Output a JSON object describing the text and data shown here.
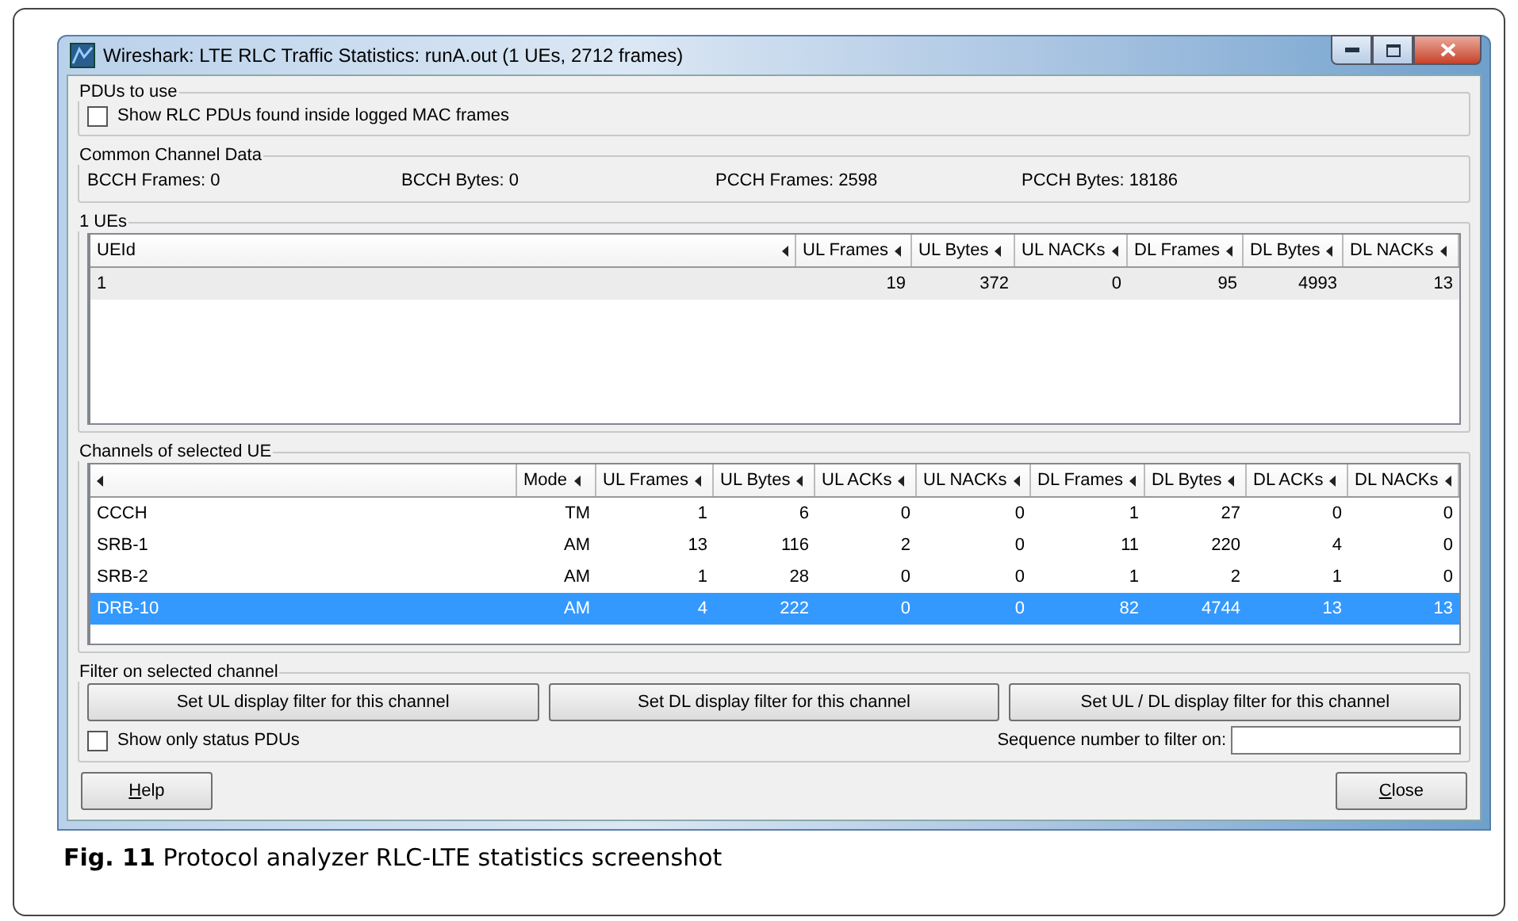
{
  "window": {
    "title": "Wireshark: LTE RLC Traffic Statistics: runA.out (1 UEs, 2712 frames)"
  },
  "pdus_to_use": {
    "legend": "PDUs to use",
    "checkbox": {
      "label": "Show RLC PDUs found inside logged MAC frames",
      "checked": false
    }
  },
  "common_channel_data": {
    "legend": "Common Channel Data",
    "fields": [
      "BCCH Frames: 0",
      "BCCH Bytes: 0",
      "PCCH Frames: 2598",
      "PCCH Bytes: 18186"
    ]
  },
  "ues": {
    "legend": "1 UEs",
    "has_focus": false,
    "columns": [
      "UEId",
      "UL Frames",
      "UL Bytes",
      "UL NACKs",
      "DL Frames",
      "DL Bytes",
      "DL NACKs"
    ],
    "rows": [
      {
        "selected": true,
        "cells": [
          "1",
          "19",
          "372",
          "0",
          "95",
          "4993",
          "13"
        ]
      }
    ]
  },
  "channels": {
    "legend": "Channels of selected UE",
    "has_focus": true,
    "columns": [
      "",
      "Mode",
      "UL Frames",
      "UL Bytes",
      "UL ACKs",
      "UL NACKs",
      "DL Frames",
      "DL Bytes",
      "DL ACKs",
      "DL NACKs"
    ],
    "rows": [
      {
        "selected": false,
        "cells": [
          "CCCH",
          "TM",
          "1",
          "6",
          "0",
          "0",
          "1",
          "27",
          "0",
          "0"
        ]
      },
      {
        "selected": false,
        "cells": [
          "SRB-1",
          "AM",
          "13",
          "116",
          "2",
          "0",
          "11",
          "220",
          "4",
          "0"
        ]
      },
      {
        "selected": false,
        "cells": [
          "SRB-2",
          "AM",
          "1",
          "28",
          "0",
          "0",
          "1",
          "2",
          "1",
          "0"
        ]
      },
      {
        "selected": true,
        "cells": [
          "DRB-10",
          "AM",
          "4",
          "222",
          "0",
          "0",
          "82",
          "4744",
          "13",
          "13"
        ]
      }
    ]
  },
  "filter": {
    "legend": "Filter on selected channel",
    "buttons": [
      "Set UL display filter for this channel",
      "Set DL display filter for this channel",
      "Set UL / DL display filter for this channel"
    ],
    "checkbox": {
      "label": "Show only status PDUs",
      "checked": false
    },
    "sequence_label": "Sequence number to filter on:"
  },
  "buttons": [
    "Help",
    "Close"
  ],
  "caption": {
    "number": "Fig. 11",
    "text": "Protocol analyzer RLC-LTE statistics screenshot"
  }
}
